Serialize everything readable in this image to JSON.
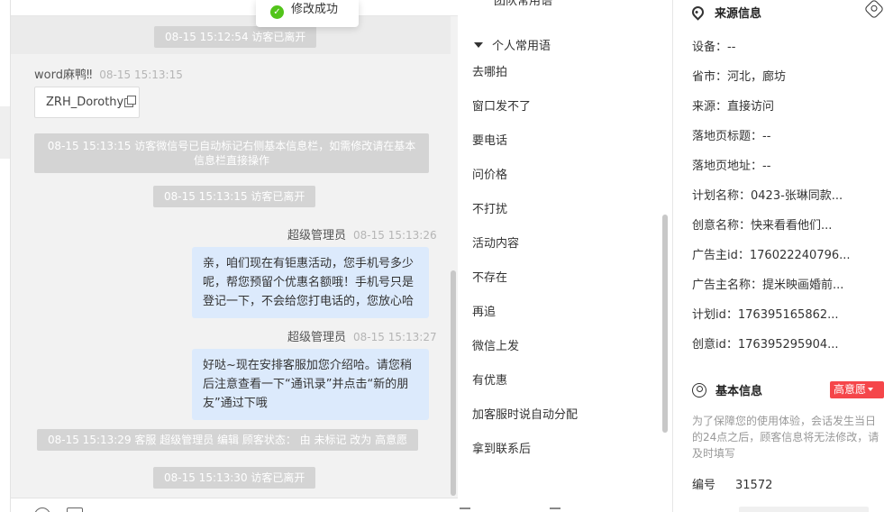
{
  "toast": {
    "text": "修改成功"
  },
  "chat": {
    "name_tag": "ZRH_Dorothy",
    "messages": [
      {
        "type": "system",
        "text": "08-15 15:12:54 访客已离开"
      },
      {
        "type": "visitor",
        "name": "word麻鸭‼",
        "time": "08-15 15:13:15"
      },
      {
        "type": "system",
        "text": "08-15 15:13:15 访客微信号已自动标记右侧基本信息栏，如需修改请在基本信息栏直接操作"
      },
      {
        "type": "system",
        "text": "08-15 15:13:15 访客已离开"
      },
      {
        "type": "agent",
        "name": "超级管理员",
        "time": "08-15 15:13:26",
        "text": "亲，咱们现在有钜惠活动，您手机号多少呢，帮您预留个优惠名额哦！手机号只是登记一下，不会给您打电话的，您放心哈"
      },
      {
        "type": "agent",
        "name": "超级管理员",
        "time": "08-15 15:13:27",
        "text": "好哒~现在安排客服加您介绍哈。请您稍后注意查看一下“通讯录”并点击“新的朋友”通过下哦"
      },
      {
        "type": "system",
        "text": "08-15 15:13:29 客服 超级管理员 编辑 顾客状态： 由 未标记 改为 高意愿"
      },
      {
        "type": "system",
        "text": "08-15 15:13:30 访客已离开"
      }
    ]
  },
  "phrases": {
    "prev_group": "团队常用语",
    "group": "个人常用语",
    "items": [
      "去哪拍",
      "窗口发不了",
      "要电话",
      "问价格",
      "不打扰",
      "活动内容",
      "不存在",
      "再追",
      "微信上发",
      "有优惠",
      "加客服时说自动分配",
      "拿到联系后"
    ]
  },
  "source": {
    "title": "来源信息",
    "rows": [
      {
        "label": "设备：",
        "value": "--"
      },
      {
        "label": "省市：",
        "value": "河北，廊坊"
      },
      {
        "label": "来源：",
        "value": "直接访问"
      },
      {
        "label": "落地页标题：",
        "value": "--"
      },
      {
        "label": "落地页地址：",
        "value": "--"
      },
      {
        "label": "计划名称：",
        "value": "0423-张琳同款..."
      },
      {
        "label": "创意名称：",
        "value": "快来看看他们..."
      },
      {
        "label": "广告主id：",
        "value": "176022240796..."
      },
      {
        "label": "广告主名称：",
        "value": "提米映画婚前..."
      },
      {
        "label": "计划id：",
        "value": "176395165862..."
      },
      {
        "label": "创意id：",
        "value": "176395295904..."
      }
    ]
  },
  "basic": {
    "title": "基本信息",
    "badge": "高意愿",
    "badge_color": "#f5464a",
    "notice": "为了保障您的使用体验，会话发生当日的24点之后，顾客信息将无法修改，请及时填写",
    "id_label": "编号",
    "id_value": "31572"
  }
}
